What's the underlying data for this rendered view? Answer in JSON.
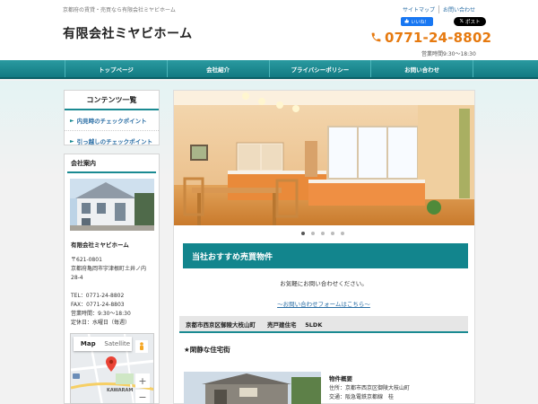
{
  "header": {
    "tagline": "京都府の賃貸・売買なら有限会社ミヤビホーム",
    "title": "有限会社ミヤビホーム",
    "toplinks": [
      "サイトマップ",
      "お問い合わせ"
    ],
    "fb_like": "いいね！",
    "x_post": "ポスト",
    "phone": "0771-24-8802",
    "hours": "営業時間9:30～18:30"
  },
  "nav": [
    "トップページ",
    "会社紹介",
    "プライバシーポリシー",
    "お問い合わせ"
  ],
  "sidebar": {
    "contents_heading": "コンテンツ一覧",
    "links": [
      "内見時のチェックポイント",
      "引っ越しのチェックポイント"
    ],
    "company_heading": "会社案内",
    "company_name": "有限会社ミヤビホーム",
    "address_lines": [
      "〒621-0801",
      "京都府亀岡市宇津根町土井ノ内",
      "28-4"
    ],
    "contact_lines": [
      "TEL：0771-24-8802",
      "FAX：0771-24-8803",
      "営業時間：9:30～18:30",
      "定休日：水曜日（毎週）"
    ],
    "map": {
      "map_label": "Map",
      "satellite_label": "Satellite",
      "place_label": "KAWARAM"
    }
  },
  "main": {
    "slider_dots": 5,
    "section_title": "当社おすすめ売買物件",
    "contact_note": "お気軽にお問い合わせください。",
    "contact_link": "～お問い合わせフォームはこちら～",
    "property_heading": "京都市西京区御陵大枝山町　　売戸建住宅　 5LDK",
    "quiet": "★閑静な住宅街",
    "overview_title": "物件概要",
    "overview_lines": [
      "住所：京都市西京区御陵大枝山町",
      "交通：阪急電鉄京都線　桂"
    ]
  },
  "colors": {
    "teal": "#12858d",
    "orange": "#e67a10",
    "link": "#2a6ea5"
  }
}
